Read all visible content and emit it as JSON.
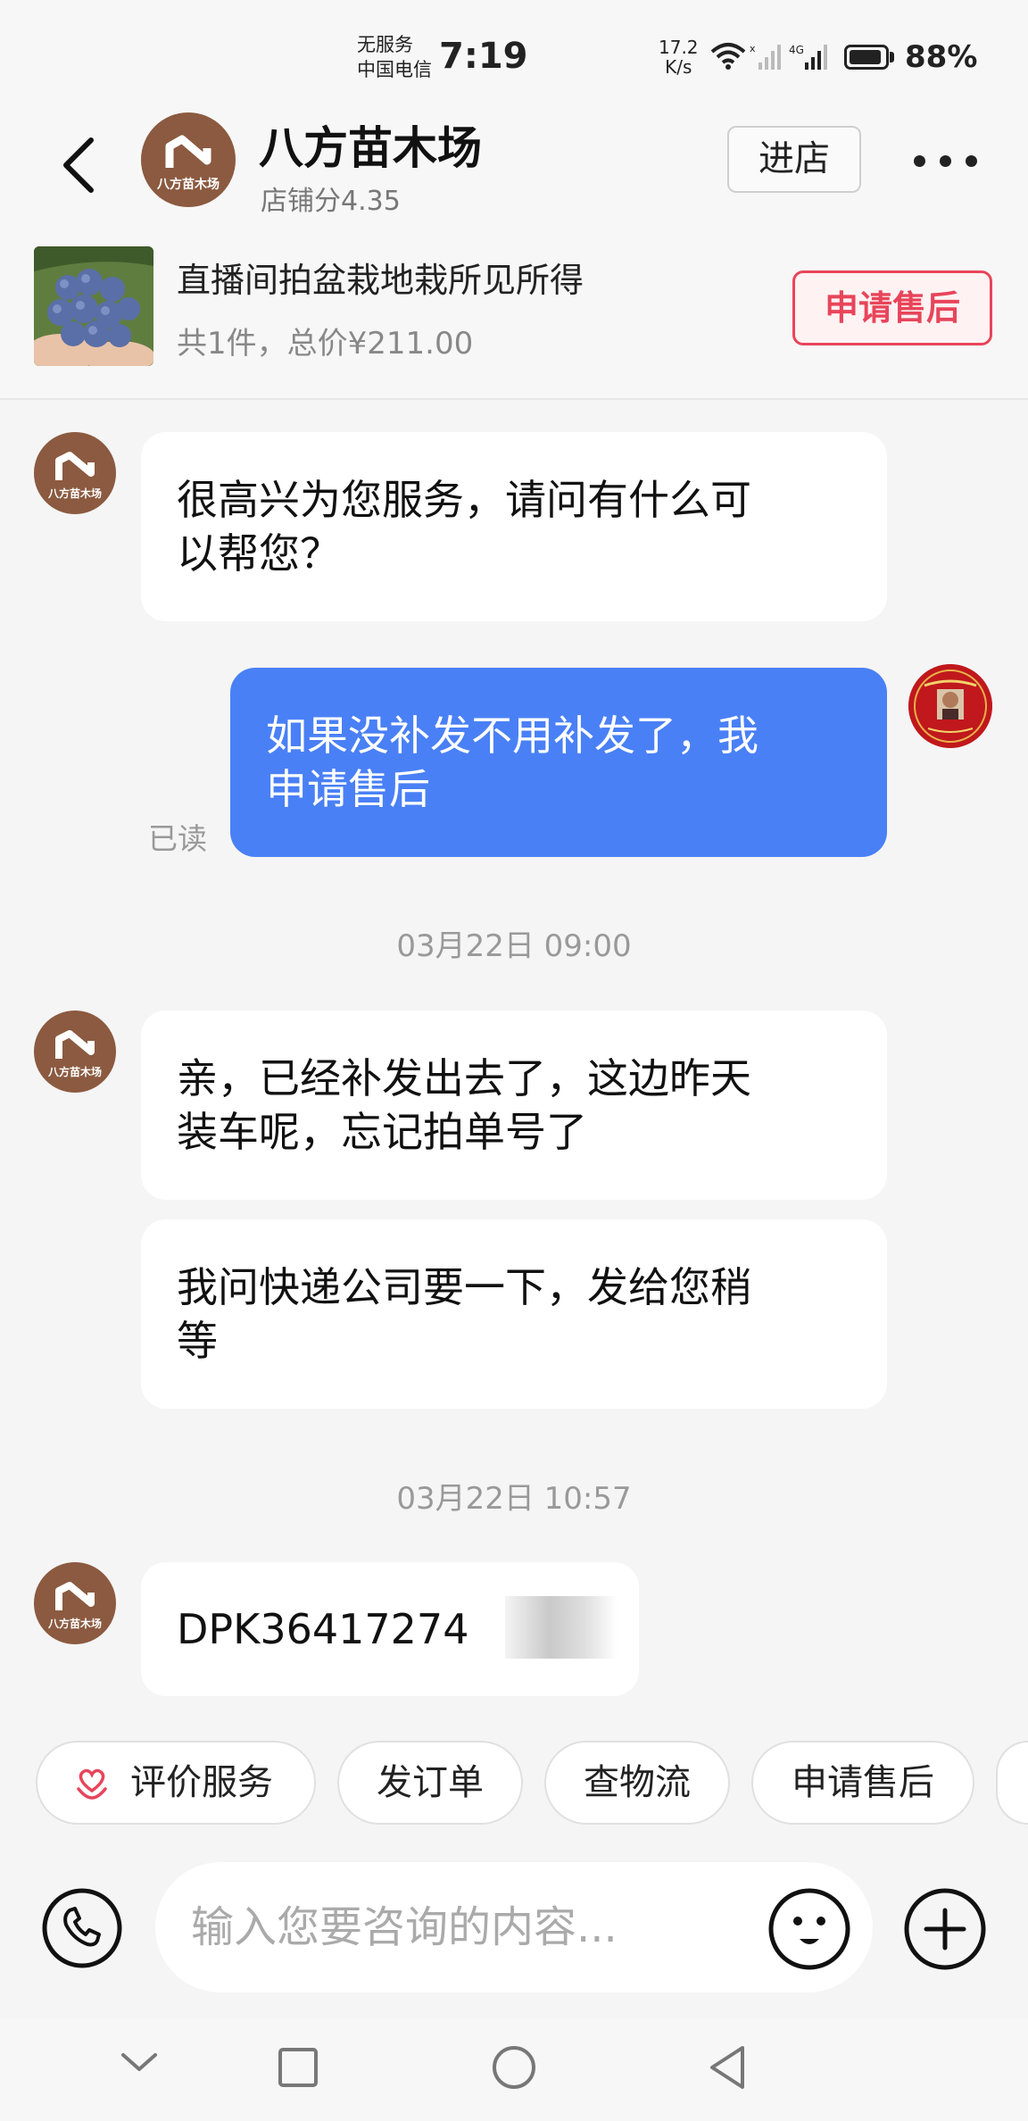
{
  "status_bar": {
    "service": "无服务",
    "carrier": "中国电信",
    "time": "7:19",
    "speed_value": "17.2",
    "speed_unit": "K/s",
    "battery": "88%",
    "battery_level": 0.88,
    "network": "4G"
  },
  "header": {
    "back_icon": "chevron-left-icon",
    "shop_name": "八方苗木场",
    "shop_avatar_text": "八方苗木场",
    "shop_score": "店铺分4.35",
    "enter_label": "进店",
    "more_icon": "more-dots-icon"
  },
  "product": {
    "title": "直播间拍盆栽地栽所见所得",
    "price_summary": "共1件，总价¥211.00",
    "after_sale_label": "申请售后"
  },
  "messages": [
    {
      "sender": "shop",
      "text_lines": [
        "很高兴为您服务，请问有什么可",
        "以帮您？"
      ]
    },
    {
      "sender": "user",
      "text_lines": [
        "如果没补发不用补发了，我",
        "申请售后"
      ],
      "status": "已读"
    },
    {
      "timestamp": "03月22日 09:00"
    },
    {
      "sender": "shop",
      "text_lines": [
        "亲，已经补发出去了，这边昨天",
        "装车呢，忘记拍单号了"
      ]
    },
    {
      "sender": "shop",
      "text_lines": [
        "我问快递公司要一下，发给您稍",
        "等"
      ]
    },
    {
      "timestamp": "03月22日 10:57"
    },
    {
      "sender": "shop",
      "text_lines": [
        "DPK36417274"
      ]
    }
  ],
  "quick_actions": [
    {
      "label": "评价服务",
      "icon": "heart-hands-icon"
    },
    {
      "label": "发订单"
    },
    {
      "label": "查物流"
    },
    {
      "label": "申请售后"
    }
  ],
  "input": {
    "placeholder": "输入您要咨询的内容..."
  },
  "colors": {
    "accent_blue": "#4a80f6",
    "after_sale_red": "#e8455a",
    "shop_brown": "#8b5a40"
  }
}
